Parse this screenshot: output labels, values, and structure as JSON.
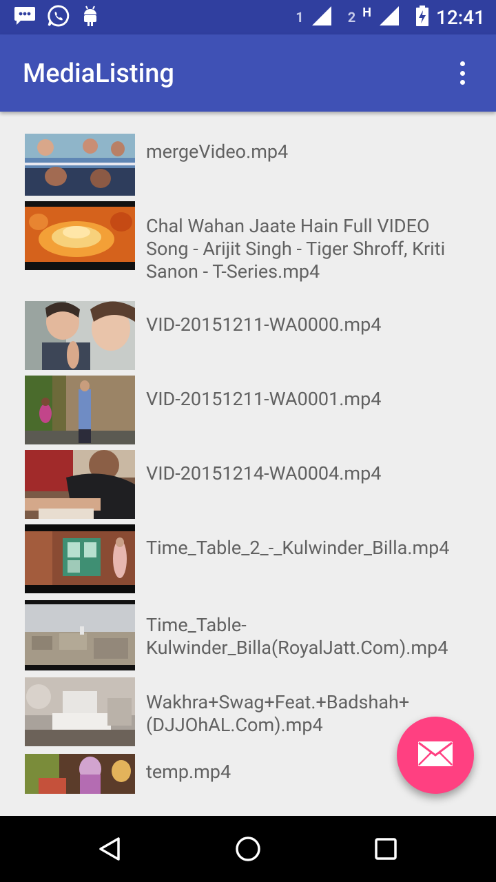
{
  "status_bar": {
    "icons": [
      "message-icon",
      "whatsapp-icon",
      "android-icon"
    ],
    "sim1_label": "1",
    "sim2_label": "2",
    "network_type": "H",
    "time": "12:41"
  },
  "app_bar": {
    "title": "MediaListing",
    "overflow_icon": "more-vert-icon"
  },
  "media": {
    "items": [
      {
        "title": "mergeVideo.mp4"
      },
      {
        "title": "Chal Wahan Jaate Hain Full VIDEO Song - Arijit Singh - Tiger Shroff, Kriti Sanon - T-Series.mp4"
      },
      {
        "title": "VID-20151211-WA0000.mp4"
      },
      {
        "title": "VID-20151211-WA0001.mp4"
      },
      {
        "title": "VID-20151214-WA0004.mp4"
      },
      {
        "title": "Time_Table_2_-_Kulwinder_Billa.mp4"
      },
      {
        "title": "Time_Table-Kulwinder_Billa(RoyalJatt.Com).mp4"
      },
      {
        "title": "Wakhra+Swag+Feat.+Badshah+(DJJOhAL.Com).mp4"
      },
      {
        "title": "temp.mp4"
      }
    ]
  },
  "fab": {
    "icon": "mail-icon",
    "color": "#ff4081"
  },
  "nav_bar": {
    "icons": [
      "back-icon",
      "home-icon",
      "recents-icon"
    ]
  },
  "colors": {
    "primary": "#3f51b5",
    "primary_dark": "#303f9f",
    "accent": "#ff4081",
    "background": "#eeeeee",
    "text": "#616161"
  }
}
